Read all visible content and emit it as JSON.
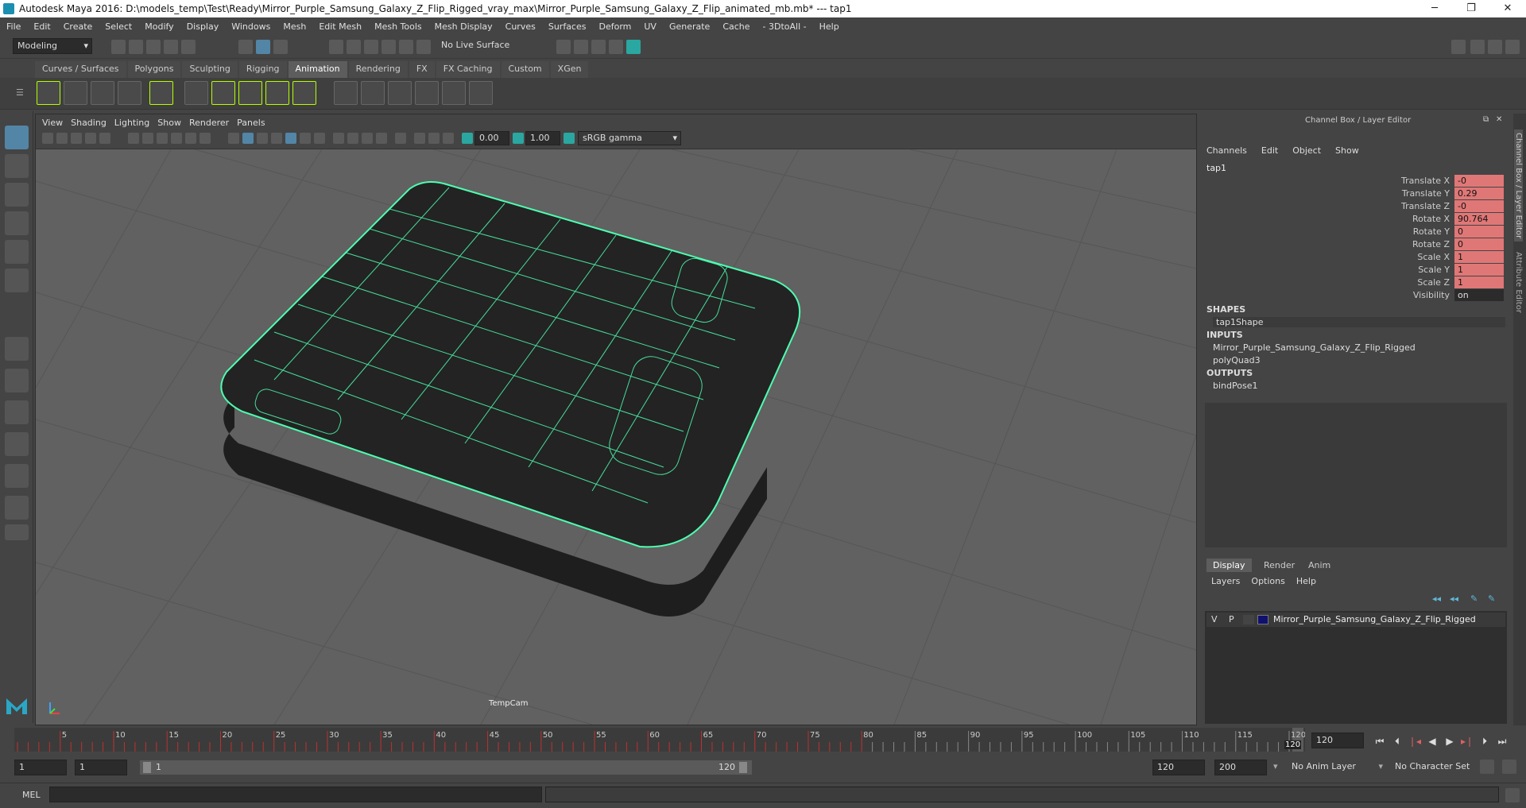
{
  "titlebar": {
    "title": "Autodesk Maya 2016: D:\\models_temp\\Test\\Ready\\Mirror_Purple_Samsung_Galaxy_Z_Flip_Rigged_vray_max\\Mirror_Purple_Samsung_Galaxy_Z_Flip_animated_mb.mb*   ---   tap1",
    "minimize": "─",
    "restore": "❐",
    "close": "✕"
  },
  "menubar": {
    "items": [
      "File",
      "Edit",
      "Create",
      "Select",
      "Modify",
      "Display",
      "Windows",
      "Mesh",
      "Edit Mesh",
      "Mesh Tools",
      "Mesh Display",
      "Curves",
      "Surfaces",
      "Deform",
      "UV",
      "Generate",
      "Cache",
      "- 3DtoAll -",
      "Help"
    ]
  },
  "statusline": {
    "mode": "Modeling",
    "live_surface": "No Live Surface"
  },
  "shelf": {
    "tabs": [
      "Curves / Surfaces",
      "Polygons",
      "Sculpting",
      "Rigging",
      "Animation",
      "Rendering",
      "FX",
      "FX Caching",
      "Custom",
      "XGen"
    ],
    "active_tab": "Animation"
  },
  "panel": {
    "menus": [
      "View",
      "Shading",
      "Lighting",
      "Show",
      "Renderer",
      "Panels"
    ],
    "exposure": "0.00",
    "gamma": "1.00",
    "color_space": "sRGB gamma",
    "camera_label": "TempCam"
  },
  "channelbox": {
    "title": "Channel Box / Layer Editor",
    "menus": [
      "Channels",
      "Edit",
      "Object",
      "Show"
    ],
    "object_name": "tap1",
    "channels": [
      {
        "label": "Translate X",
        "value": "-0"
      },
      {
        "label": "Translate Y",
        "value": "0.29"
      },
      {
        "label": "Translate Z",
        "value": "-0"
      },
      {
        "label": "Rotate X",
        "value": "90.764"
      },
      {
        "label": "Rotate Y",
        "value": "0"
      },
      {
        "label": "Rotate Z",
        "value": "0"
      },
      {
        "label": "Scale X",
        "value": "1"
      },
      {
        "label": "Scale Y",
        "value": "1"
      },
      {
        "label": "Scale Z",
        "value": "1"
      },
      {
        "label": "Visibility",
        "value": "on"
      }
    ],
    "shapes_header": "SHAPES",
    "shapes": [
      "tap1Shape"
    ],
    "inputs_header": "INPUTS",
    "inputs": [
      "Mirror_Purple_Samsung_Galaxy_Z_Flip_Rigged",
      "polyQuad3"
    ],
    "outputs_header": "OUTPUTS",
    "outputs": [
      "bindPose1"
    ]
  },
  "layereditor": {
    "tabs": [
      "Display",
      "Render",
      "Anim"
    ],
    "active_tab": "Display",
    "menus": [
      "Layers",
      "Options",
      "Help"
    ],
    "layer": {
      "v": "V",
      "p": "P",
      "name": "Mirror_Purple_Samsung_Galaxy_Z_Flip_Rigged",
      "color": "#10106e"
    }
  },
  "sidetabs": {
    "channel_box": "Channel Box / Layer Editor",
    "attribute_editor": "Attribute Editor"
  },
  "timeslider": {
    "ticks": [
      "5",
      "10",
      "15",
      "20",
      "25",
      "30",
      "35",
      "40",
      "45",
      "50",
      "55",
      "60",
      "65",
      "70",
      "75",
      "80",
      "85",
      "90",
      "95",
      "100",
      "105",
      "110",
      "115",
      "120"
    ],
    "current_frame": "120",
    "current_frame_field": "120"
  },
  "rangeslider": {
    "start": "1",
    "playback_start": "1",
    "range_start_label": "1",
    "range_end_label": "120",
    "playback_end": "120",
    "end": "200",
    "anim_layer": "No Anim Layer",
    "character_set": "No Character Set"
  },
  "cmdline": {
    "label": "MEL"
  },
  "colors": {
    "wireframe": "#4dffb0",
    "key_field": "#e07777",
    "timeline_keys": "#c03030"
  }
}
